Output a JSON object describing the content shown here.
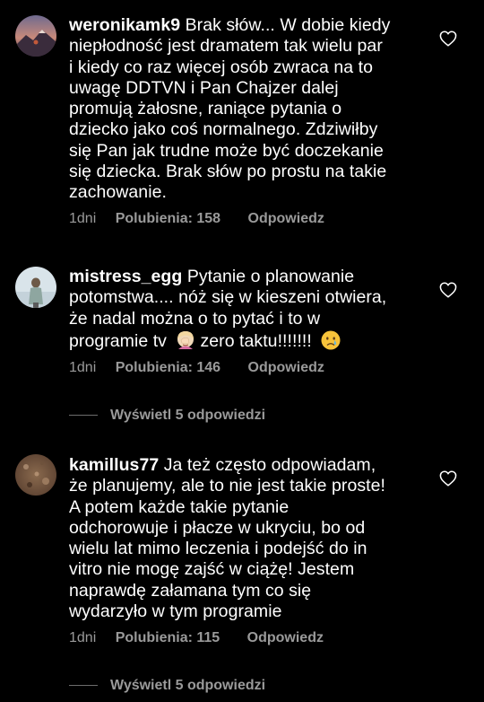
{
  "comments": [
    {
      "username": "weronikamk9",
      "lines": [
        "Brak słów... W dobie kiedy",
        "niepłodność jest dramatem tak wielu par",
        "i kiedy co raz więcej osób zwraca na to",
        "uwagę DDTVN i Pan Chajzer dalej",
        "promują żałosne, raniące pytania o",
        "dziecko jako coś normalnego. Zdziwiłby",
        "się Pan jak trudne może być doczekanie",
        "się dziecka. Brak słów po prostu na takie",
        "zachowanie."
      ],
      "time": "1dni",
      "likes": "Polubienia: 158",
      "reply": "Odpowiedz"
    },
    {
      "username": "mistress_egg",
      "lines": [
        "Pytanie o planowanie",
        "potomstwa.... nóż się w kieszeni otwiera,",
        "że nadal można o to pytać i to w",
        "programie tv",
        "zero taktu!!!!!!!"
      ],
      "emojis": [
        "woman-facepalming-emoji",
        "crying-face-emoji"
      ],
      "time": "1dni",
      "likes": "Polubienia: 146",
      "reply": "Odpowiedz",
      "view_replies": "Wyświetl 5 odpowiedzi"
    },
    {
      "username": "kamillus77",
      "lines": [
        "Ja też często odpowiadam,",
        "że planujemy, ale to nie jest takie proste!",
        "A potem każde takie pytanie",
        "odchorowuje i płacze w ukryciu, bo od",
        "wielu lat mimo leczenia i podejść do in",
        "vitro nie mogę zajść w ciążę! Jestem",
        "naprawdę załamana tym co się",
        "wydarzyło w tym programie"
      ],
      "time": "1dni",
      "likes": "Polubienia: 115",
      "reply": "Odpowiedz",
      "view_replies": "Wyświetl 5 odpowiedzi"
    }
  ],
  "icons": {
    "like": "heart-outline-icon"
  },
  "colors": {
    "background": "#000000",
    "text": "#ffffff",
    "meta": "#9a9a9a"
  }
}
